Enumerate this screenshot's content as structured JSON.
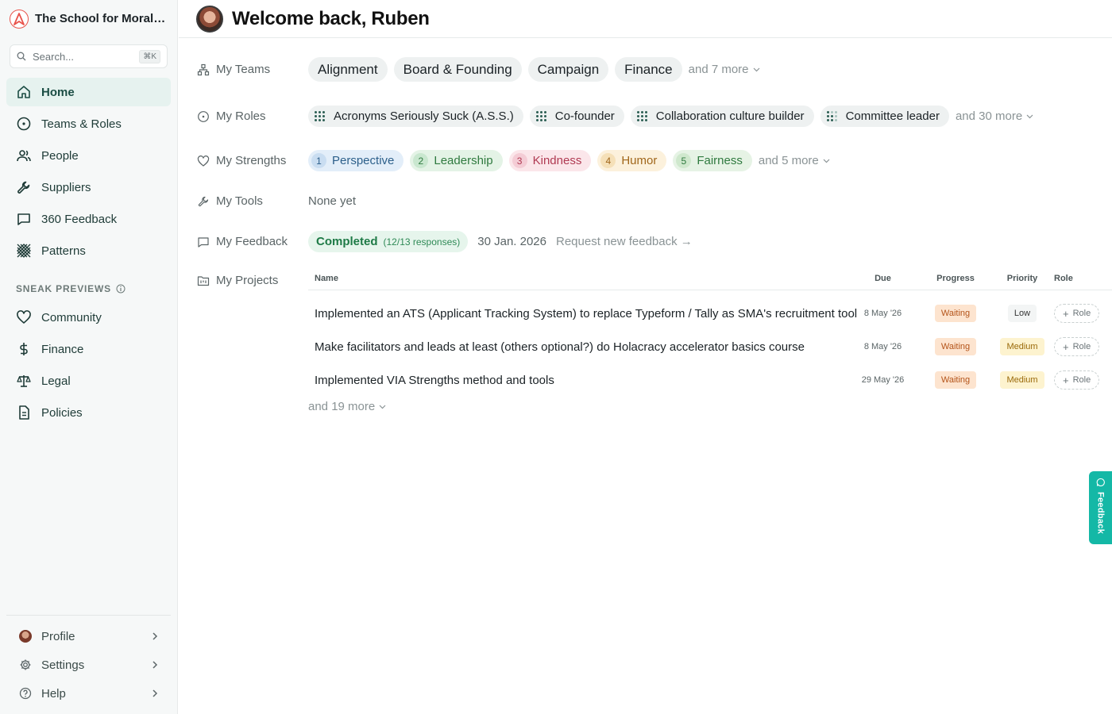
{
  "app": {
    "org_name": "The School for Moral A...",
    "accent_color": "#1b4d44",
    "logo_color": "#e8524a"
  },
  "search": {
    "placeholder": "Search...",
    "shortcut": "⌘K"
  },
  "sidebar": {
    "nav": [
      {
        "label": "Home",
        "icon": "home-icon",
        "active": true
      },
      {
        "label": "Teams & Roles",
        "icon": "circle-target-icon"
      },
      {
        "label": "People",
        "icon": "people-icon"
      },
      {
        "label": "Suppliers",
        "icon": "wrench-icon"
      },
      {
        "label": "360 Feedback",
        "icon": "message-square-icon"
      },
      {
        "label": "Patterns",
        "icon": "patterns-icon"
      }
    ],
    "section_title": "SNEAK PREVIEWS",
    "previews": [
      {
        "label": "Community",
        "icon": "heart-icon"
      },
      {
        "label": "Finance",
        "icon": "dollar-icon"
      },
      {
        "label": "Legal",
        "icon": "scales-icon"
      },
      {
        "label": "Policies",
        "icon": "document-icon"
      }
    ],
    "bottom": [
      {
        "label": "Profile",
        "icon": "avatar"
      },
      {
        "label": "Settings",
        "icon": "gear-icon"
      },
      {
        "label": "Help",
        "icon": "help-icon"
      }
    ]
  },
  "header": {
    "welcome": "Welcome back, Ruben"
  },
  "teams": {
    "label": "My Teams",
    "items": [
      "Alignment",
      "Board & Founding",
      "Campaign",
      "Finance"
    ],
    "more": "and 7 more"
  },
  "roles": {
    "label": "My Roles",
    "items": [
      "Acronyms Seriously Suck (A.S.S.)",
      "Co-founder",
      "Collaboration culture builder",
      "Committee leader"
    ],
    "more": "and 30 more"
  },
  "strengths": {
    "label": "My Strengths",
    "items": [
      {
        "rank": "1",
        "name": "Perspective",
        "bg": "#e3eef9",
        "fg": "#2c5f8a",
        "num_bg": "#c9ddf1"
      },
      {
        "rank": "2",
        "name": "Leadership",
        "bg": "#e4f3e6",
        "fg": "#2f7a3f",
        "num_bg": "#c9e7cf"
      },
      {
        "rank": "3",
        "name": "Kindness",
        "bg": "#fbe6ea",
        "fg": "#b03a52",
        "num_bg": "#f4ccd5"
      },
      {
        "rank": "4",
        "name": "Humor",
        "bg": "#fcf1dc",
        "fg": "#a0661a",
        "num_bg": "#f5e0b8"
      },
      {
        "rank": "5",
        "name": "Fairness",
        "bg": "#e6f3e5",
        "fg": "#2f7a3f",
        "num_bg": "#cfe8cd"
      }
    ],
    "more": "and 5 more"
  },
  "tools": {
    "label": "My Tools",
    "value": "None yet"
  },
  "feedback": {
    "label": "My Feedback",
    "status": "Completed",
    "responses": "(12/13 responses)",
    "date": "30 Jan. 2026",
    "request": "Request new feedback →"
  },
  "projects": {
    "label": "My Projects",
    "columns": [
      "Name",
      "Due",
      "Progress",
      "Priority",
      "Role"
    ],
    "rows": [
      {
        "name": "Implemented an ATS (Applicant Tracking System) to replace Typeform / Tally as SMA's recruitment tool",
        "due": "8 May '26",
        "progress": "Waiting",
        "priority": "Low",
        "role": "Role"
      },
      {
        "name": "Make facilitators and leads at least (others optional?) do Holacracy accelerator basics course",
        "due": "8 May '26",
        "progress": "Waiting",
        "priority": "Medium",
        "role": "Role"
      },
      {
        "name": "Implemented VIA Strengths method and tools",
        "due": "29 May '26",
        "progress": "Waiting",
        "priority": "Medium",
        "role": "Role"
      }
    ],
    "more": "and 19 more"
  },
  "feedback_tab": {
    "label": "Feedback",
    "color": "#14b8a6"
  }
}
